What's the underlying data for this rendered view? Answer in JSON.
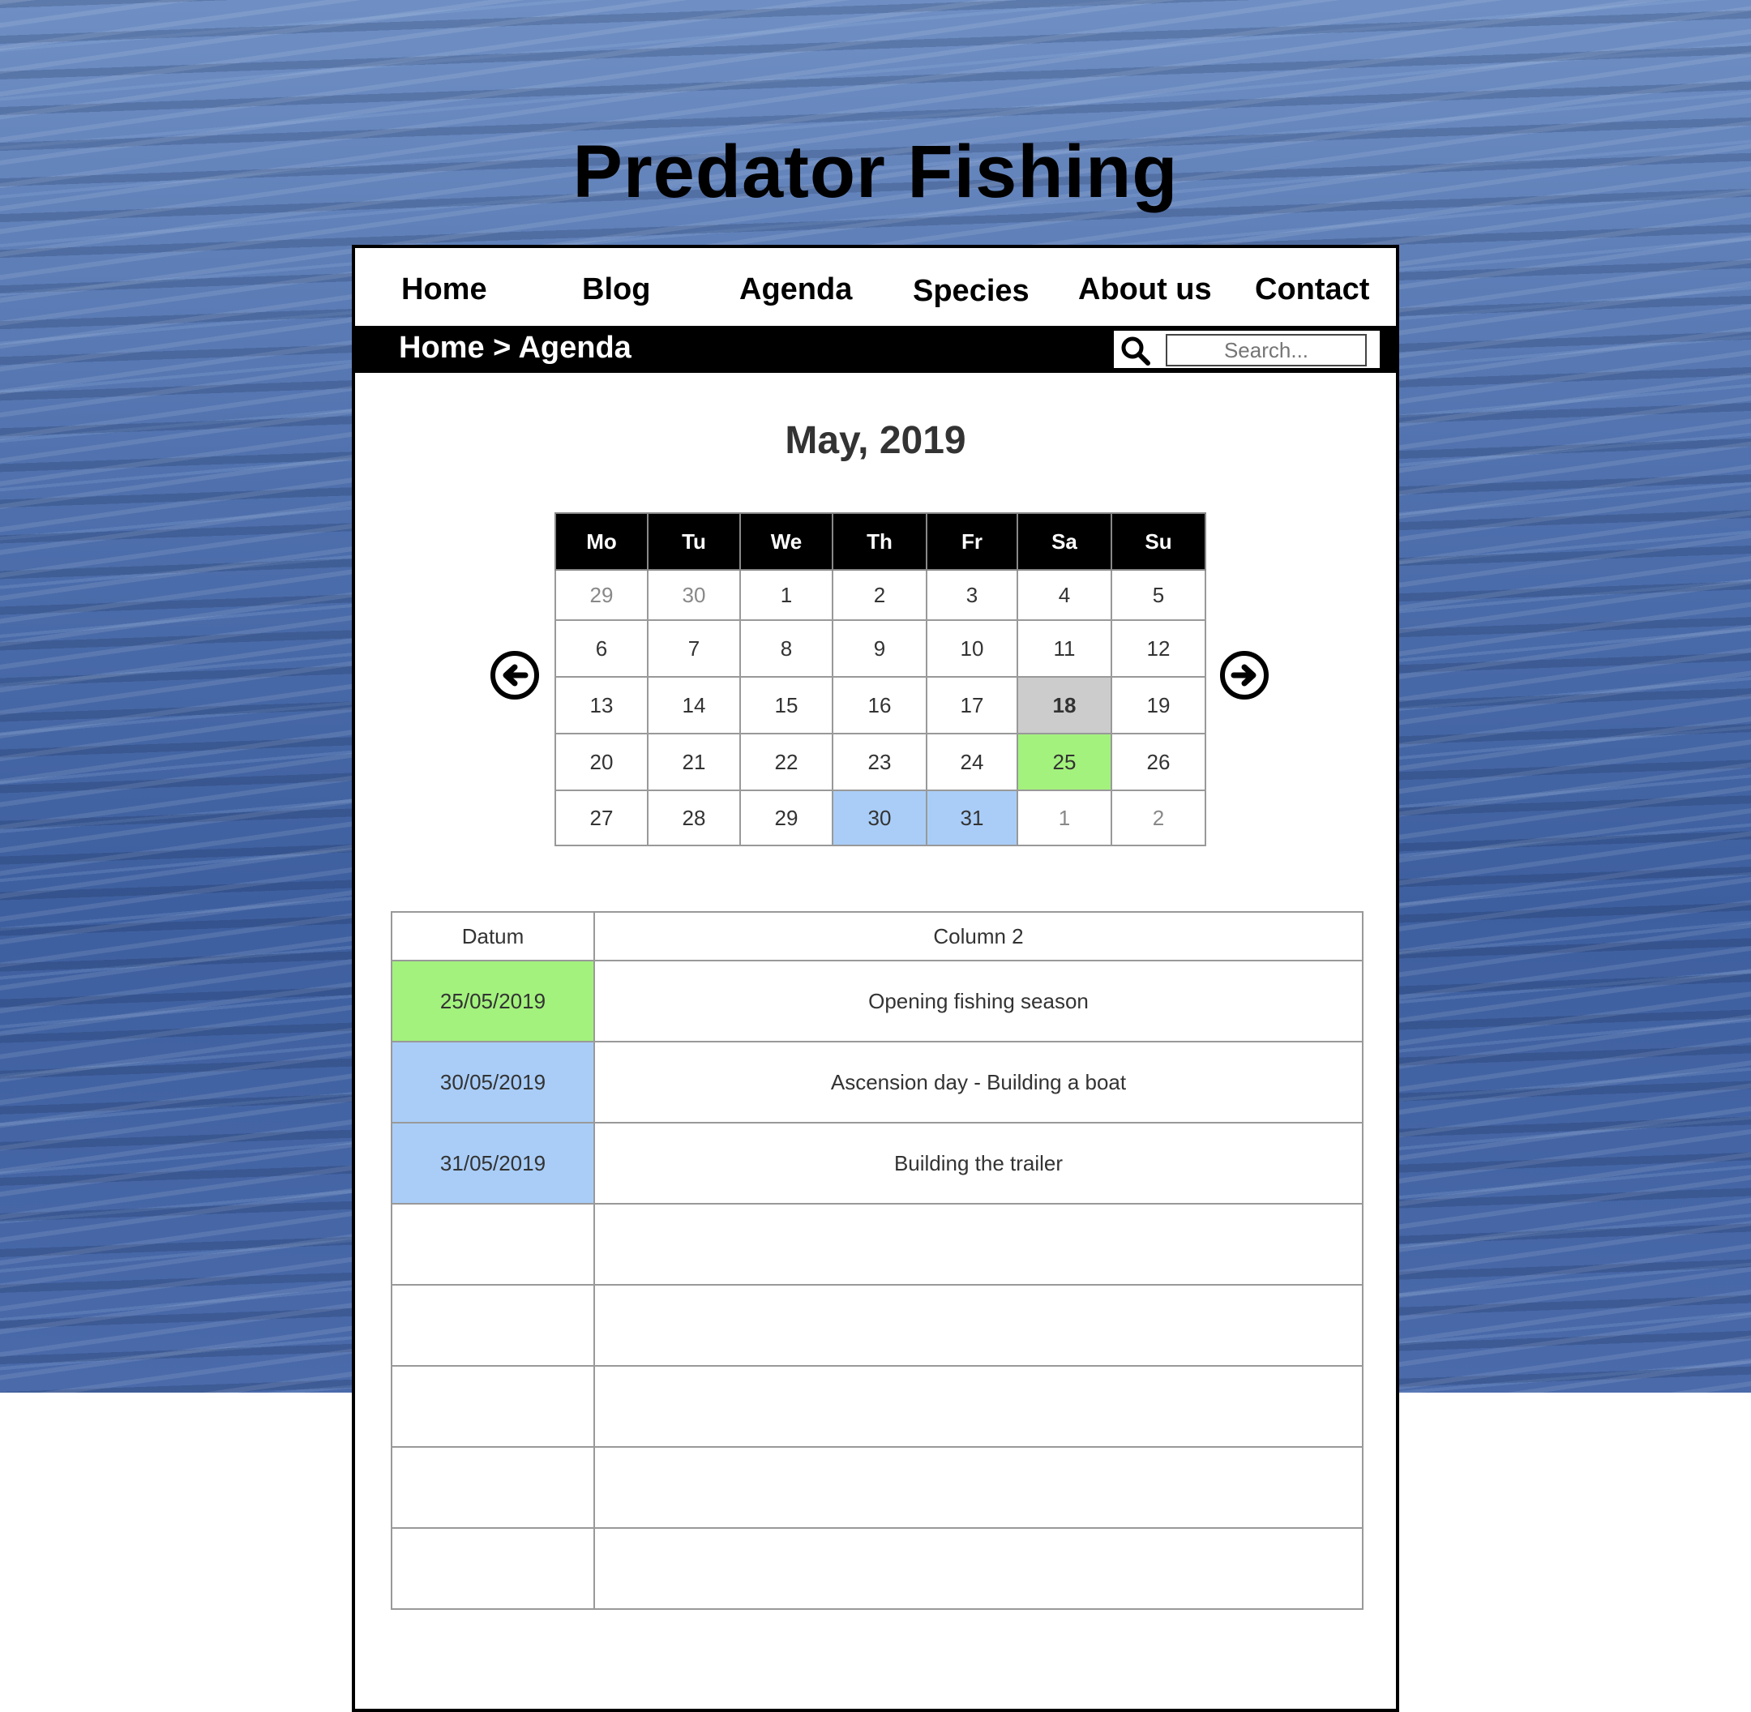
{
  "site": {
    "title": "Predator Fishing"
  },
  "nav": [
    {
      "label": "Home"
    },
    {
      "label": "Blog"
    },
    {
      "label": "Agenda"
    },
    {
      "label": "Species"
    },
    {
      "label": "About us"
    },
    {
      "label": "Contact"
    }
  ],
  "breadcrumb": "Home > Agenda",
  "search": {
    "placeholder": "Search..."
  },
  "calendar": {
    "month_label": "May, 2019",
    "weekdays": [
      "Mo",
      "Tu",
      "We",
      "Th",
      "Fr",
      "Sa",
      "Su"
    ],
    "weeks": [
      [
        {
          "d": "29",
          "s": "muted"
        },
        {
          "d": "30",
          "s": "muted"
        },
        {
          "d": "1"
        },
        {
          "d": "2"
        },
        {
          "d": "3"
        },
        {
          "d": "4"
        },
        {
          "d": "5"
        }
      ],
      [
        {
          "d": "6"
        },
        {
          "d": "7"
        },
        {
          "d": "8"
        },
        {
          "d": "9"
        },
        {
          "d": "10"
        },
        {
          "d": "11"
        },
        {
          "d": "12"
        }
      ],
      [
        {
          "d": "13"
        },
        {
          "d": "14"
        },
        {
          "d": "15"
        },
        {
          "d": "16"
        },
        {
          "d": "17"
        },
        {
          "d": "18",
          "s": "today"
        },
        {
          "d": "19"
        }
      ],
      [
        {
          "d": "20"
        },
        {
          "d": "21"
        },
        {
          "d": "22"
        },
        {
          "d": "23"
        },
        {
          "d": "24"
        },
        {
          "d": "25",
          "s": "green"
        },
        {
          "d": "26"
        }
      ],
      [
        {
          "d": "27"
        },
        {
          "d": "28"
        },
        {
          "d": "29"
        },
        {
          "d": "30",
          "s": "blue"
        },
        {
          "d": "31",
          "s": "blue"
        },
        {
          "d": "1",
          "s": "muted"
        },
        {
          "d": "2",
          "s": "muted"
        }
      ]
    ],
    "prev_icon": "arrow-left-circle-icon",
    "next_icon": "arrow-right-circle-icon"
  },
  "agenda": {
    "columns": [
      "Datum",
      "Column 2"
    ],
    "rows": [
      {
        "date": "25/05/2019",
        "event": "Opening fishing season",
        "color": "green"
      },
      {
        "date": "30/05/2019",
        "event": "Ascension day - Building a boat",
        "color": "blue"
      },
      {
        "date": "31/05/2019",
        "event": "Building the trailer",
        "color": "blue"
      },
      {
        "date": "",
        "event": ""
      },
      {
        "date": "",
        "event": ""
      },
      {
        "date": "",
        "event": ""
      },
      {
        "date": "",
        "event": ""
      },
      {
        "date": "",
        "event": ""
      }
    ]
  },
  "colors": {
    "event_green": "#a3f27d",
    "event_blue": "#a9cdf7",
    "today_gray": "#cccccc"
  }
}
